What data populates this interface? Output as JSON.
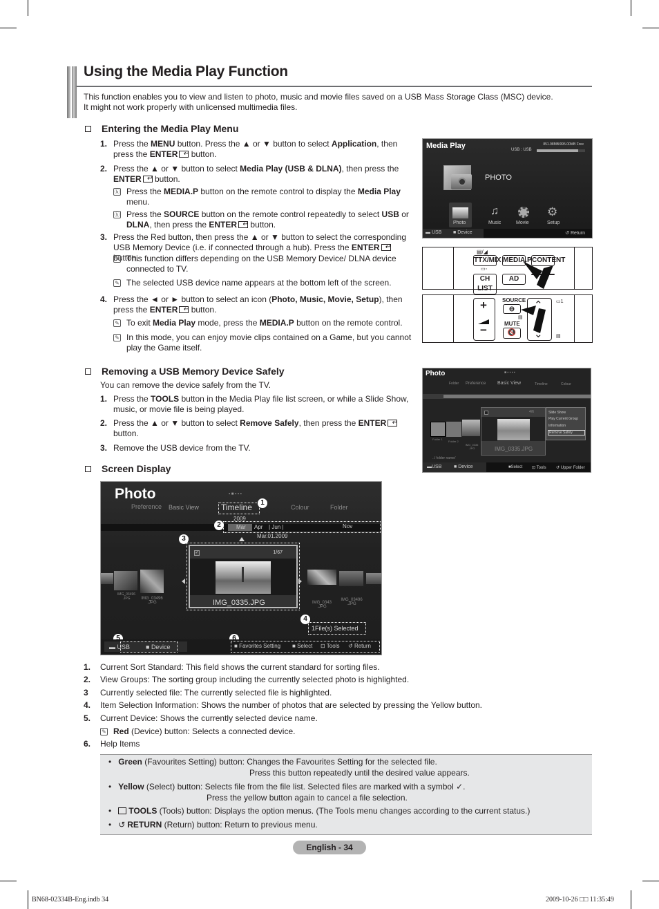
{
  "title": "Using the Media Play Function",
  "intro": [
    "This function enables you to view and listen to photo, music and movie files saved on a USB Mass Storage Class (MSC) device.",
    "It might not work properly with unlicensed multimedia files."
  ],
  "section1": {
    "heading": "Entering the Media Play Menu",
    "steps": [
      {
        "num": "1.",
        "lines": [
          "Press the <b>MENU</b> button. Press the ▲ or ▼ button to select <b>Application</b>, then",
          "press the <b>ENTER</b><i class='enter-ic'></i> button."
        ]
      },
      {
        "num": "2.",
        "lines": [
          "Press the ▲ or ▼ button to select <b>Media Play (USB &amp; DLNA)</b>, then press the",
          "<b>ENTER</b><i class='enter-ic'></i> button."
        ]
      },
      {
        "num": "3.",
        "lines": [
          "Press the Red button, then press the ▲ or ▼ button to select the corresponding",
          "USB Memory Device (i.e. if connected through a hub). Press the <b>ENTER</b><i class='enter-ic'></i> button."
        ]
      },
      {
        "num": "4.",
        "lines": [
          "Press the ◄ or ► button to select an icon (<b>Photo, Music, Movie, Setup</b>), then",
          "press the <b>ENTER</b><i class='enter-ic'></i> button."
        ]
      }
    ],
    "notes": [
      {
        "lines": [
          "Press the <b>MEDIA.P</b> button on the remote control to display the <b>Media Play</b>",
          "menu."
        ]
      },
      {
        "lines": [
          "Press the <b>SOURCE</b> button on the remote control repeatedly to select <b>USB</b> or",
          "<b>DLNA</b>, then press the <b>ENTER</b><i class='enter-ic'></i> button."
        ]
      },
      {
        "lines": [
          "This function differs depending on the USB Memory Device/ DLNA device",
          "connected to TV."
        ]
      },
      {
        "lines": [
          "The selected USB device name appears at the bottom left of the screen."
        ]
      },
      {
        "lines": [
          "To exit <b>Media Play</b> mode, press the <b>MEDIA.P</b> button on the remote control."
        ]
      },
      {
        "lines": [
          "In this mode, you can enjoy movie clips contained on a Game, but you cannot",
          "play the Game itself."
        ]
      }
    ]
  },
  "section2": {
    "heading": "Removing a USB Memory Device Safely",
    "lead": "You can remove the device safely from the TV.",
    "steps": [
      {
        "num": "1.",
        "lines": [
          "Press the <b>TOOLS</b> button in the Media Play file list screen, or while a Slide Show,",
          "music, or movie file is being played."
        ]
      },
      {
        "num": "2.",
        "lines": [
          "Press the ▲ or ▼ button to select <b>Remove Safely</b>, then press the <b>ENTER</b><i class='enter-ic'></i>",
          "button."
        ]
      },
      {
        "num": "3.",
        "lines": [
          "Remove the USB device from the TV."
        ]
      }
    ]
  },
  "section3": {
    "heading": "Screen Display"
  },
  "media_play_screen": {
    "title": "Media Play",
    "storage": "851.98MB/995.00MB Free",
    "storage_used_fraction": 0.86,
    "device": "USB : USB",
    "current": "PHOTO",
    "icons": [
      "Photo",
      "Music",
      "Movie",
      "Setup"
    ],
    "footer_usb": "USB",
    "footer_device": "Device",
    "footer_return": "Return"
  },
  "remote1": {
    "buttons": [
      "TTX/MIX",
      "MEDIA.P",
      "CONTENT",
      "CH LIST",
      "AD"
    ]
  },
  "remote2": {
    "source": "SOURCE",
    "mute": "MUTE"
  },
  "photo_small": {
    "title": "Photo",
    "tabs": [
      "Folder",
      "Preference",
      "Basic View",
      "Timeline",
      "Colour"
    ],
    "thumbs": [
      "Folder 1",
      "Folder 2",
      "IMG_0335 .JPG"
    ],
    "count": "4/6",
    "filename": "IMG_0335.JPG",
    "path": "../ folder name/",
    "menu": [
      "Slide Show",
      "Play Current Group",
      "Information",
      "Remove Safely"
    ],
    "footer": {
      "usb": "USB",
      "device": "Device",
      "select": "Select",
      "tools": "Tools",
      "upper": "Upper Folder"
    }
  },
  "photo_large": {
    "title": "Photo",
    "tabs": [
      "Preference",
      "Basic View",
      "Timeline",
      "Colour",
      "Folder"
    ],
    "year": "2009",
    "months": [
      "Mar",
      "Apr",
      "Jun",
      "Nov"
    ],
    "date": "Mar.01.2009",
    "count": "1/67",
    "filename": "IMG_0335.JPG",
    "left_thumbs": [
      "IMG_03496 .JPG",
      "IMG_03496 .JPG"
    ],
    "right_thumbs": [
      "IMG_0343 .JPG",
      "IMG_03496 .JPG"
    ],
    "selected": "1File(s) Selected",
    "footer": {
      "usb": "USB",
      "device": "Device",
      "favorites": "Favorites Setting",
      "select": "Select",
      "tools": "Tools",
      "return": "Return"
    },
    "callouts": [
      "1",
      "2",
      "3",
      "4",
      "5",
      "6"
    ]
  },
  "legend": [
    {
      "num": "1.",
      "text": "Current Sort Standard: This field shows the current standard for sorting files."
    },
    {
      "num": "2.",
      "text": "View Groups: The sorting group including the currently selected photo is highlighted."
    },
    {
      "num": "3",
      "text": "Currently selected file: The currently selected file is highlighted."
    },
    {
      "num": "4.",
      "text": "Item Selection Information: Shows the number of photos that are selected by pressing the Yellow button."
    },
    {
      "num": "5.",
      "text": "Current Device: Shows the currently selected device name."
    },
    {
      "num": "6.",
      "text": "Help Items"
    }
  ],
  "legend_note": "<b>Red</b> (Device) button: Selects a connected device.",
  "help": [
    {
      "text": "<b>Green</b> (Favourites Setting) button: Changes the Favourites Setting for the selected file.",
      "cont": "Press this button repeatedly until the desired value appears."
    },
    {
      "text": "<b>Yellow</b> (Select) button: Selects file from the file list. Selected files are marked with a symbol ✓.",
      "cont": "Press the yellow button again to cancel a file selection."
    },
    {
      "text": "<b>TOOLS</b> (Tools) button: Displays the option menus. (The Tools menu changes according to the current status.)"
    },
    {
      "text": "<b>RETURN</b> (Return) button: Return to previous menu."
    }
  ],
  "page_label": "English - 34",
  "slug_left": "BN68-02334B-Eng.indb   34",
  "slug_right": "2009-10-26   □□ 11:35:49"
}
